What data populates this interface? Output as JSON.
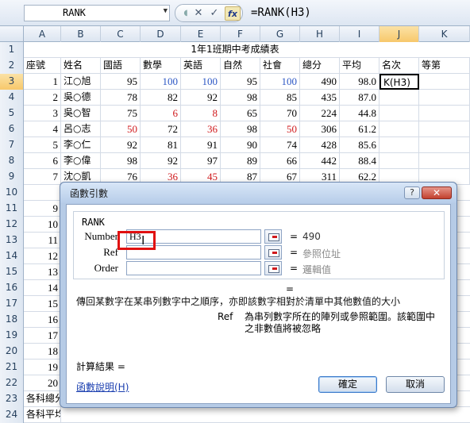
{
  "formula_bar": {
    "name_box": "RANK",
    "cancel_icon": "✕",
    "enter_icon": "✓",
    "fx_label": "fx",
    "formula": "=RANK(H3)"
  },
  "columns": [
    "A",
    "B",
    "C",
    "D",
    "E",
    "F",
    "G",
    "H",
    "I",
    "J",
    "K"
  ],
  "title": "1年1班期中考成績表",
  "headers": [
    "座號",
    "姓名",
    "國語",
    "數學",
    "英語",
    "自然",
    "社會",
    "總分",
    "平均",
    "名次",
    "等第"
  ],
  "students": [
    {
      "row": "3",
      "no": "1",
      "name": "江○旭",
      "c": "95",
      "d": "100",
      "e": "100",
      "f": "95",
      "g": "100",
      "total": "490",
      "avg": "98.0",
      "rank": "K(H3)"
    },
    {
      "row": "4",
      "no": "2",
      "name": "吳○德",
      "c": "78",
      "d": "82",
      "e": "92",
      "f": "98",
      "g": "85",
      "total": "435",
      "avg": "87.0",
      "rank": ""
    },
    {
      "row": "5",
      "no": "3",
      "name": "吳○智",
      "c": "75",
      "d": "6",
      "e": "8",
      "f": "65",
      "g": "70",
      "total": "224",
      "avg": "44.8",
      "rank": ""
    },
    {
      "row": "6",
      "no": "4",
      "name": "呂○志",
      "c": "50",
      "d": "72",
      "e": "36",
      "f": "98",
      "g": "50",
      "total": "306",
      "avg": "61.2",
      "rank": ""
    },
    {
      "row": "7",
      "no": "5",
      "name": "李○仁",
      "c": "92",
      "d": "81",
      "e": "91",
      "f": "90",
      "g": "74",
      "total": "428",
      "avg": "85.6",
      "rank": ""
    },
    {
      "row": "8",
      "no": "6",
      "name": "李○偉",
      "c": "98",
      "d": "92",
      "e": "97",
      "f": "89",
      "g": "66",
      "total": "442",
      "avg": "88.4",
      "rank": ""
    },
    {
      "row": "9",
      "no": "7",
      "name": "沈○凱",
      "c": "76",
      "d": "36",
      "e": "45",
      "f": "87",
      "g": "67",
      "total": "311",
      "avg": "62.2",
      "rank": ""
    }
  ],
  "side_rows": [
    {
      "row": "10",
      "no": ""
    },
    {
      "row": "11",
      "no": "9"
    },
    {
      "row": "12",
      "no": "10"
    },
    {
      "row": "13",
      "no": "11"
    },
    {
      "row": "14",
      "no": "12"
    },
    {
      "row": "15",
      "no": "13"
    },
    {
      "row": "16",
      "no": "14"
    },
    {
      "row": "17",
      "no": "15"
    },
    {
      "row": "18",
      "no": "16"
    },
    {
      "row": "19",
      "no": "17"
    },
    {
      "row": "20",
      "no": "18"
    },
    {
      "row": "21",
      "no": "19"
    },
    {
      "row": "22",
      "no": "20"
    },
    {
      "row": "23",
      "no": "各科總分"
    },
    {
      "row": "24",
      "no": "各科平均"
    }
  ],
  "dialog": {
    "title": "函數引數",
    "help_icon": "?",
    "close_icon": "✕",
    "function_name": "RANK",
    "args": [
      {
        "label": "Number",
        "value": "H3",
        "eq": "=",
        "result": "490"
      },
      {
        "label": "Ref",
        "value": "",
        "eq": "=",
        "result": "參照位址"
      },
      {
        "label": "Order",
        "value": "",
        "eq": "=",
        "result": "邏輯值"
      }
    ],
    "desc_eq": "=",
    "description": "傳回某數字在某串列數字中之順序，亦即該數字相對於清單中其他數值的大小",
    "ref_name": "Ref",
    "ref_desc": "為串列數字所在的陣列或參照範圍。該範圍中之非數值將被忽略",
    "result_label": "計算結果 =",
    "help_link": "函數說明(H)",
    "ok": "確定",
    "cancel": "取消"
  }
}
